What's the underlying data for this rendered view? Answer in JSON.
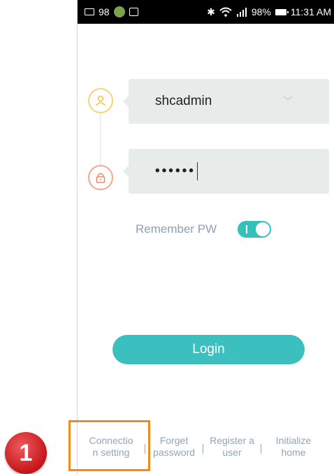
{
  "statusbar": {
    "notif_count": "98",
    "battery": "98%",
    "time": "11:31 AM",
    "icons": [
      "mail-icon",
      "app-icon",
      "bag-icon",
      "bluetooth-icon",
      "wifi-icon",
      "signal-icon",
      "battery-icon"
    ]
  },
  "login": {
    "username_value": "shcadmin",
    "password_masked": "••••••",
    "remember_label": "Remember PW",
    "remember_on": true,
    "button_label": "Login"
  },
  "links": [
    {
      "label": "Connectio\nn setting"
    },
    {
      "label": "Forget\npassword"
    },
    {
      "label": "Register a\nuser"
    },
    {
      "label": "Initialize\nhome"
    }
  ],
  "annotation": {
    "step": "1"
  },
  "colors": {
    "accent": "#3cc0bf",
    "user_ring": "#f5d47a",
    "lock_ring": "#f2a78c",
    "highlight": "#f4891c",
    "badge": "#c4161c"
  }
}
